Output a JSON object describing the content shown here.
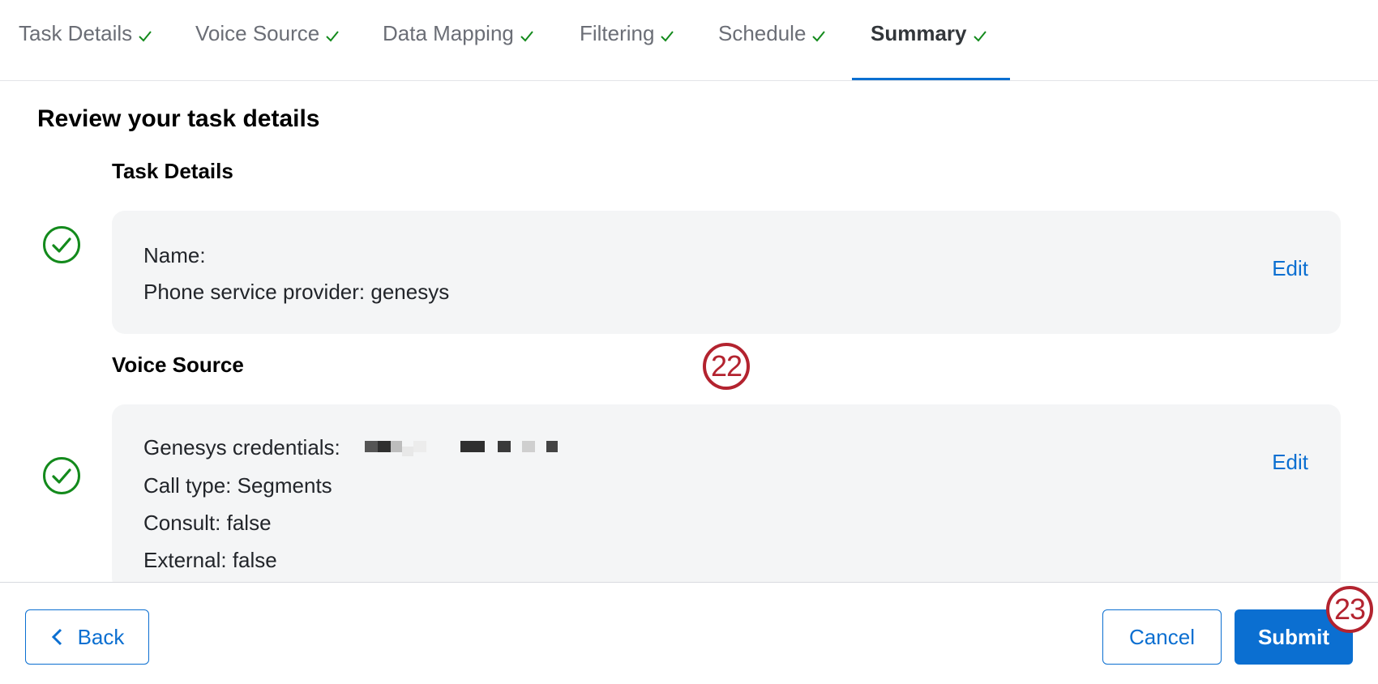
{
  "tabs": [
    {
      "label": "Task Details"
    },
    {
      "label": "Voice Source"
    },
    {
      "label": "Data Mapping"
    },
    {
      "label": "Filtering"
    },
    {
      "label": "Schedule"
    },
    {
      "label": "Summary",
      "active": true
    }
  ],
  "icons": {
    "tab_check": "check-icon",
    "section_status": "check-circle-icon",
    "back": "chevron-left-icon"
  },
  "colors": {
    "accent": "#0b6fd1",
    "success": "#138a1c",
    "annotation": "#b3232f"
  },
  "page_heading": "Review your task details",
  "sections": [
    {
      "title": "Task Details",
      "lines": [
        "Name:",
        "Phone service provider: genesys"
      ],
      "edit_label": "Edit"
    },
    {
      "title": "Voice Source",
      "credentials_label": "Genesys credentials:",
      "lines": [
        "Call type: Segments",
        "Consult: false",
        "External: false"
      ],
      "edit_label": "Edit"
    }
  ],
  "annotations": [
    "22",
    "23"
  ],
  "footer": {
    "back_label": "Back",
    "cancel_label": "Cancel",
    "submit_label": "Submit"
  }
}
